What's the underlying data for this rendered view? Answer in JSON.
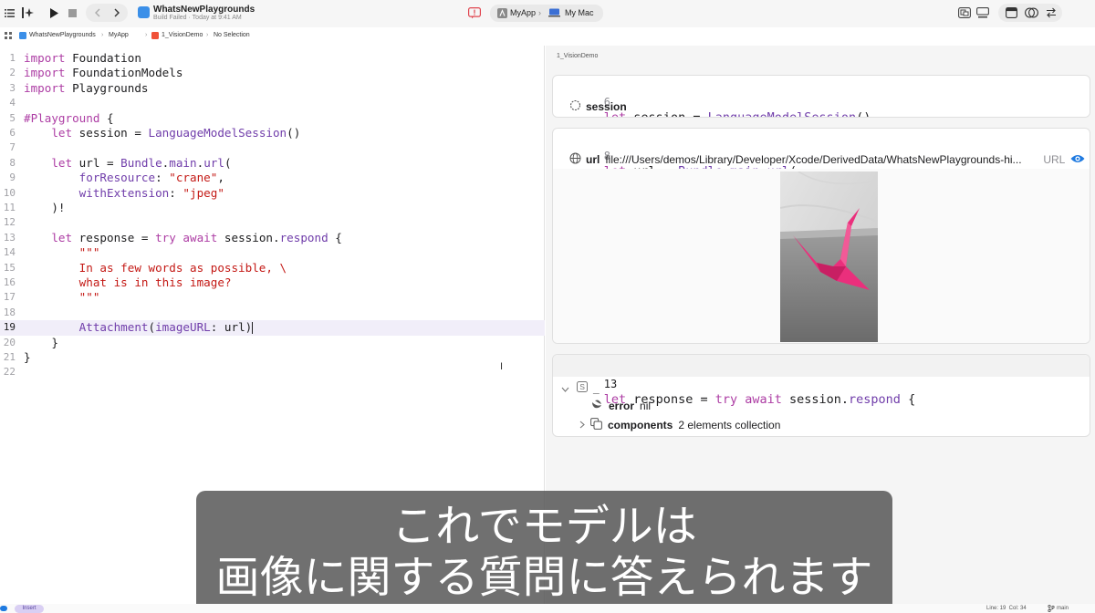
{
  "toolbar": {
    "project_title": "WhatsNewPlaygrounds",
    "build_status": "Build Failed · Today at 9:41 AM",
    "scheme_target": "MyApp",
    "scheme_destination": "My Mac"
  },
  "jumpbar": {
    "items": [
      "WhatsNewPlaygrounds",
      "MyApp",
      "1_VisionDemo",
      "No Selection"
    ]
  },
  "editor": {
    "lines": [
      {
        "n": "1",
        "html": "<span class=\"kw\">import</span> Foundation"
      },
      {
        "n": "2",
        "html": "<span class=\"kw\">import</span> FoundationModels"
      },
      {
        "n": "3",
        "html": "<span class=\"kw\">import</span> Playgrounds"
      },
      {
        "n": "4",
        "html": ""
      },
      {
        "n": "5",
        "html": "<span class=\"kw\">#Playground</span> {"
      },
      {
        "n": "6",
        "html": "    <span class=\"kw\">let</span> session = <span class=\"typ\">LanguageModelSession</span>()"
      },
      {
        "n": "7",
        "html": ""
      },
      {
        "n": "8",
        "html": "    <span class=\"kw\">let</span> url = <span class=\"typ\">Bundle</span>.<span class=\"typ\">main</span>.<span class=\"typ\">url</span>("
      },
      {
        "n": "9",
        "html": "        <span class=\"typ\">forResource</span>: <span class=\"str\">\"crane\"</span>,"
      },
      {
        "n": "10",
        "html": "        <span class=\"typ\">withExtension</span>: <span class=\"str\">\"jpeg\"</span>"
      },
      {
        "n": "11",
        "html": "    )!"
      },
      {
        "n": "12",
        "html": ""
      },
      {
        "n": "13",
        "html": "    <span class=\"kw\">let</span> response = <span class=\"kw\">try await</span> session.<span class=\"typ\">respond</span> {"
      },
      {
        "n": "14",
        "html": "        <span class=\"str\">\"\"\"</span>"
      },
      {
        "n": "15",
        "html": "        <span class=\"str\">In as few words as possible, \\</span>"
      },
      {
        "n": "16",
        "html": "        <span class=\"str\">what is in this image?</span>"
      },
      {
        "n": "17",
        "html": "        <span class=\"str\">\"\"\"</span>"
      },
      {
        "n": "18",
        "html": ""
      },
      {
        "n": "19",
        "html": "        <span class=\"typ\">Attachment</span>(<span class=\"typ\">imageURL</span>: url)<span class=\"caret\"></span>",
        "current": true
      },
      {
        "n": "20",
        "html": "    }"
      },
      {
        "n": "21",
        "html": "}"
      },
      {
        "n": "22",
        "html": ""
      }
    ]
  },
  "canvas": {
    "file_label": "1_VisionDemo",
    "card1": {
      "line": "6",
      "code": "let session = LanguageModelSession()",
      "result_name": "session"
    },
    "card2": {
      "line": "8",
      "code": "let url = Bundle.main.url(",
      "result_name": "url",
      "result_value": "file:///Users/demos/Library/Developer/Xcode/DerivedData/WhatsNewPlaygrounds-hi...",
      "result_type": "URL"
    },
    "card3": {
      "line": "13",
      "code": "let response = try await session.respond {",
      "root_name": "_",
      "error_name": "error",
      "error_value": "nil",
      "components_name": "components",
      "components_value": "2 elements collection"
    }
  },
  "subtitle": {
    "line1": "これでモデルは",
    "line2": "画像に関する質問に答えられます"
  },
  "status": {
    "mode": "Insert",
    "position": "Line: 19  Col: 34",
    "branch": "main"
  },
  "colors": {
    "keyword": "#ad3da4",
    "string": "#c41a16",
    "type": "#703daa",
    "accent": "#1f7ae0",
    "crane": "#ea2f7c"
  }
}
